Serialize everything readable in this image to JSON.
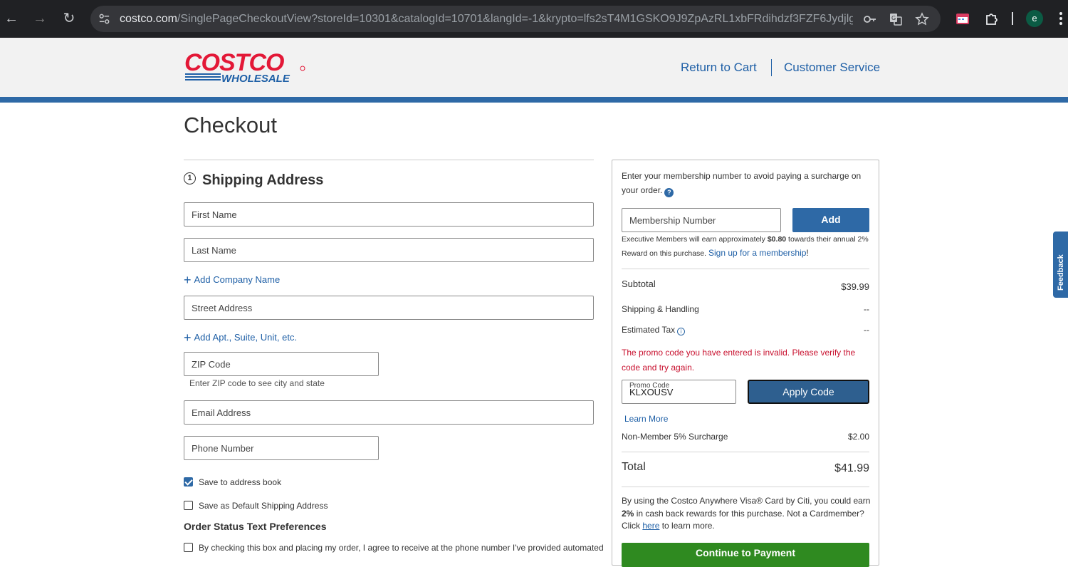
{
  "browser": {
    "url_host": "costco.com",
    "url_rest": "/SinglePageCheckoutView?storeId=10301&catalogId=10701&langId=-1&krypto=lfs2sT4M1GSKO9J9ZpAzRL1xbFRdihdzf3FZF6JydjlgVY...",
    "profile_initial": "e"
  },
  "header": {
    "logo_text_top": "COSTCO",
    "logo_text_bottom": "WHOLESALE",
    "return_to_cart": "Return to Cart",
    "customer_service": "Customer Service"
  },
  "page": {
    "title": "Checkout"
  },
  "shipping": {
    "step_number": "1",
    "title": "Shipping Address",
    "first_name_placeholder": "First Name",
    "last_name_placeholder": "Last Name",
    "add_company": "Add Company Name",
    "street_placeholder": "Street Address",
    "add_apt": "Add Apt., Suite, Unit, etc.",
    "zip_placeholder": "ZIP Code",
    "zip_hint": "Enter ZIP code to see city and state",
    "email_placeholder": "Email Address",
    "phone_placeholder": "Phone Number",
    "save_address_book": "Save to address book",
    "save_address_book_checked": true,
    "save_default": "Save as Default Shipping Address",
    "save_default_checked": false,
    "order_status_title": "Order Status Text Preferences",
    "sms_consent": "By checking this box and placing my order, I agree to receive at the phone number I've provided automated"
  },
  "summary": {
    "membership_prompt": "Enter your membership number to avoid paying a surcharge on your order.",
    "membership_placeholder": "Membership Number",
    "add_button": "Add",
    "exec_note_pre": "Executive Members will earn approximately",
    "exec_amount": "$0.80",
    "exec_note_post": "towards their annual 2% Reward on this purchase.",
    "signup_link": "Sign up for a membership",
    "signup_suffix": "!",
    "subtotal_label": "Subtotal",
    "subtotal_value": "$39.99",
    "shipping_label": "Shipping & Handling",
    "shipping_value": "--",
    "tax_label": "Estimated Tax",
    "tax_value": "--",
    "promo_error": "The promo code you have entered is invalid. Please verify the code and try again.",
    "promo_label": "Promo Code",
    "promo_value": "KLXOUSV",
    "apply_button": "Apply Code",
    "learn_more": "Learn More",
    "surcharge_label": "Non-Member 5% Surcharge",
    "surcharge_value": "$2.00",
    "total_label": "Total",
    "total_value": "$41.99",
    "visa_pre": "By using the Costco Anywhere Visa® Card by Citi, you could earn",
    "visa_bold": "2%",
    "visa_mid": "in cash back rewards for this purchase. Not a Cardmember? Click",
    "visa_link": "here",
    "visa_post": "to learn more.",
    "continue_button": "Continue to Payment"
  },
  "feedback": {
    "label": "Feedback"
  },
  "colors": {
    "brand_blue": "#2e69a6",
    "costco_red": "#e31837",
    "error_red": "#c8102e",
    "continue_green": "#2f8a20"
  }
}
